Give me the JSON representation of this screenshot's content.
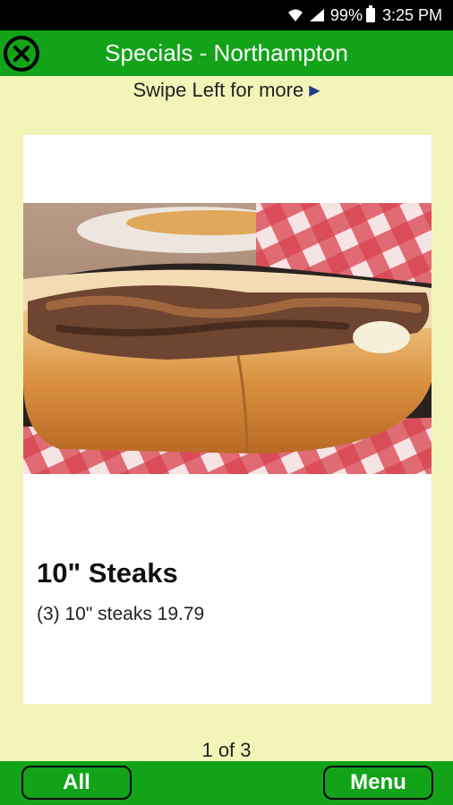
{
  "status_bar": {
    "battery": "99%",
    "time": "3:25 PM",
    "icons": [
      "wifi-icon",
      "signal-icon",
      "battery-icon"
    ]
  },
  "app_bar": {
    "title": "Specials - Northampton",
    "close_icon": "close-circle-icon"
  },
  "hint": {
    "text": "Swipe Left for more",
    "arrow_icon": "play-arrow-icon"
  },
  "special": {
    "title": "10\" Steaks",
    "description": "(3) 10\" steaks 19.79",
    "image": "cheesesteak-photo"
  },
  "pager": {
    "text": "1 of 3"
  },
  "bottom_bar": {
    "all_label": "All",
    "menu_label": "Menu"
  },
  "colors": {
    "accent_green": "#13a319",
    "background": "#f3f4b8",
    "status_bar": "#000000"
  }
}
